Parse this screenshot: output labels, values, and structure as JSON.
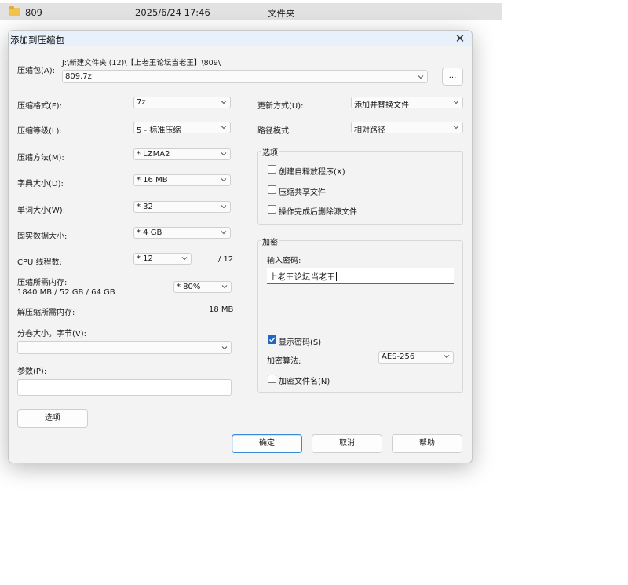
{
  "explorer": {
    "folder_name": "809",
    "date": "2025/6/24 17:46",
    "type": "文件夹",
    "icon": "folder-icon"
  },
  "dialog": {
    "title": "添加到压缩包",
    "close_icon": "close-icon",
    "archive_label": "压缩包(A):",
    "archive_path": "J:\\新建文件夹 (12)\\【上老王论坛当老王】\\809\\",
    "archive_name": "809.7z",
    "browse_label": "...",
    "left": {
      "format": {
        "label": "压缩格式(F):",
        "value": "7z"
      },
      "level": {
        "label": "压缩等级(L):",
        "value": "5 - 标准压缩"
      },
      "method": {
        "label": "压缩方法(M):",
        "value": "* LZMA2"
      },
      "dict": {
        "label": "字典大小(D):",
        "value": "* 16 MB"
      },
      "word": {
        "label": "单词大小(W):",
        "value": "* 32"
      },
      "solid": {
        "label": "固实数据大小:",
        "value": "* 4 GB"
      },
      "cpu": {
        "label": "CPU 线程数:",
        "value": "* 12",
        "total": "/ 12"
      },
      "mem_compress": {
        "label": "压缩所需内存:",
        "detail": "1840 MB / 52 GB / 64 GB",
        "value": "* 80%"
      },
      "mem_decompress": {
        "label": "解压缩所需内存:",
        "value": "18 MB"
      },
      "split": {
        "label": "分卷大小，字节(V):",
        "value": ""
      },
      "params": {
        "label": "参数(P):",
        "value": ""
      },
      "options_button": "选项"
    },
    "right": {
      "update": {
        "label": "更新方式(U):",
        "value": "添加并替换文件"
      },
      "path_mode": {
        "label": "路径模式",
        "value": "相对路径"
      },
      "options_group": {
        "title": "选项",
        "sfx": {
          "label": "创建自释放程序(X)",
          "checked": false
        },
        "shared": {
          "label": "压缩共享文件",
          "checked": false
        },
        "delete_after": {
          "label": "操作完成后删除源文件",
          "checked": false
        }
      },
      "encryption": {
        "title": "加密",
        "password_label": "输入密码:",
        "password_value": "上老王论坛当老王",
        "show_password": {
          "label": "显示密码(S)",
          "checked": true
        },
        "method_label": "加密算法:",
        "method_value": "AES-256",
        "encrypt_names": {
          "label": "加密文件名(N)",
          "checked": false
        }
      }
    },
    "buttons": {
      "ok": "确定",
      "cancel": "取消",
      "help": "帮助"
    },
    "colors": {
      "accent": "#1e67c2",
      "titlebar": "#e8f1fb",
      "dialog_bg": "#f3f3f3"
    }
  }
}
